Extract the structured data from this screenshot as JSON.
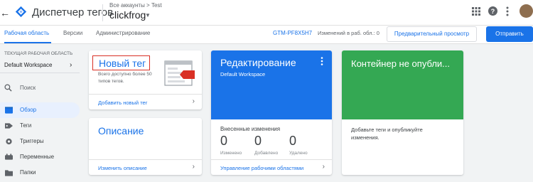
{
  "app": {
    "title": "Диспетчер тегов",
    "account_crumb": "Все аккаунты > Test",
    "container_name": "clickfrog"
  },
  "header_icons": [
    "back-arrow-icon",
    "gtm-logo-icon",
    "apps-grid-icon",
    "help-icon",
    "more-vert-icon",
    "avatar"
  ],
  "nav": {
    "tabs": [
      {
        "label": "Рабочая область",
        "active": true
      },
      {
        "label": "Версии",
        "active": false
      },
      {
        "label": "Администрирование",
        "active": false
      }
    ],
    "container_id": "GTM-PF8X5H7",
    "workspace_changes": "Изменений в раб. обл.: 0",
    "preview_label": "Предварительный просмотр",
    "submit_label": "Отправить"
  },
  "sidebar": {
    "workspace_heading": "ТЕКУЩАЯ РАБОЧАЯ ОБЛАСТЬ",
    "workspace_name": "Default Workspace",
    "search_label": "Поиск",
    "items": [
      {
        "label": "Обзор",
        "icon": "overview-icon",
        "active": true
      },
      {
        "label": "Теги",
        "icon": "tag-icon",
        "active": false
      },
      {
        "label": "Триггеры",
        "icon": "trigger-icon",
        "active": false
      },
      {
        "label": "Переменные",
        "icon": "variables-icon",
        "active": false
      },
      {
        "label": "Папки",
        "icon": "folder-icon",
        "active": false
      }
    ]
  },
  "cards": {
    "new_tag": {
      "title": "Новый тег",
      "description": "Всего доступно более 50 типов тегов.",
      "link": "Добавить новый тег"
    },
    "description": {
      "title": "Описание",
      "link": "Изменить описание"
    },
    "editing": {
      "title": "Редактирование",
      "subtitle": "Default Workspace",
      "changes_heading": "Внесенные изменения",
      "stats": [
        {
          "value": "0",
          "label": "Изменено"
        },
        {
          "value": "0",
          "label": "Добавлено"
        },
        {
          "value": "0",
          "label": "Удалено"
        }
      ],
      "link": "Управление рабочими областями"
    },
    "unpublished": {
      "title": "Контейнер не опубли...",
      "description": "Добавьте теги и опубликуйте изменения."
    }
  },
  "colors": {
    "accent": "#1a73e8",
    "editing_bg": "#1a73e8",
    "unpublished_bg": "#34a853",
    "highlight_border": "#d93025"
  }
}
